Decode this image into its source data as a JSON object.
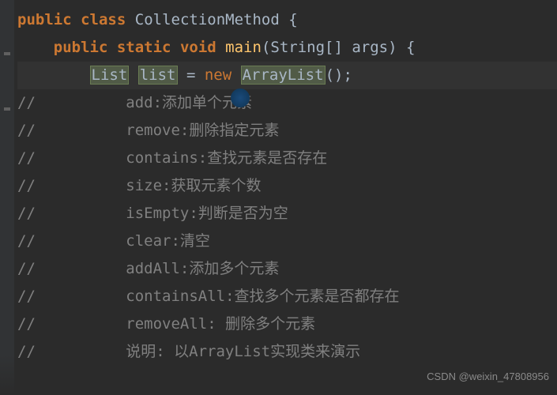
{
  "code": {
    "line1": {
      "public": "public",
      "class": "class",
      "className": "CollectionMethod",
      "brace": " {"
    },
    "line2": {
      "indent": "    ",
      "public": "public",
      "static": "static",
      "void": "void",
      "method": "main",
      "params": "(String[] args) {"
    },
    "line3": {
      "indent": "        ",
      "type1": "List",
      "space": " ",
      "var": "list",
      "eq": " = ",
      "new": "new",
      "space2": " ",
      "type2": "ArrayList",
      "tail": "();"
    },
    "comments": {
      "prefix": "//",
      "indent": "          ",
      "c1": "add:添加单个元素",
      "c2": "remove:删除指定元素",
      "c3": "contains:查找元素是否存在",
      "c4": "size:获取元素个数",
      "c5": "isEmpty:判断是否为空",
      "c6": "clear:清空",
      "c7": "addAll:添加多个元素",
      "c8": "containsAll:查找多个元素是否都存在",
      "c9": "removeAll: 删除多个元素",
      "c10": "说明: 以ArrayList实现类来演示"
    }
  },
  "watermark": "CSDN @weixin_47808956"
}
